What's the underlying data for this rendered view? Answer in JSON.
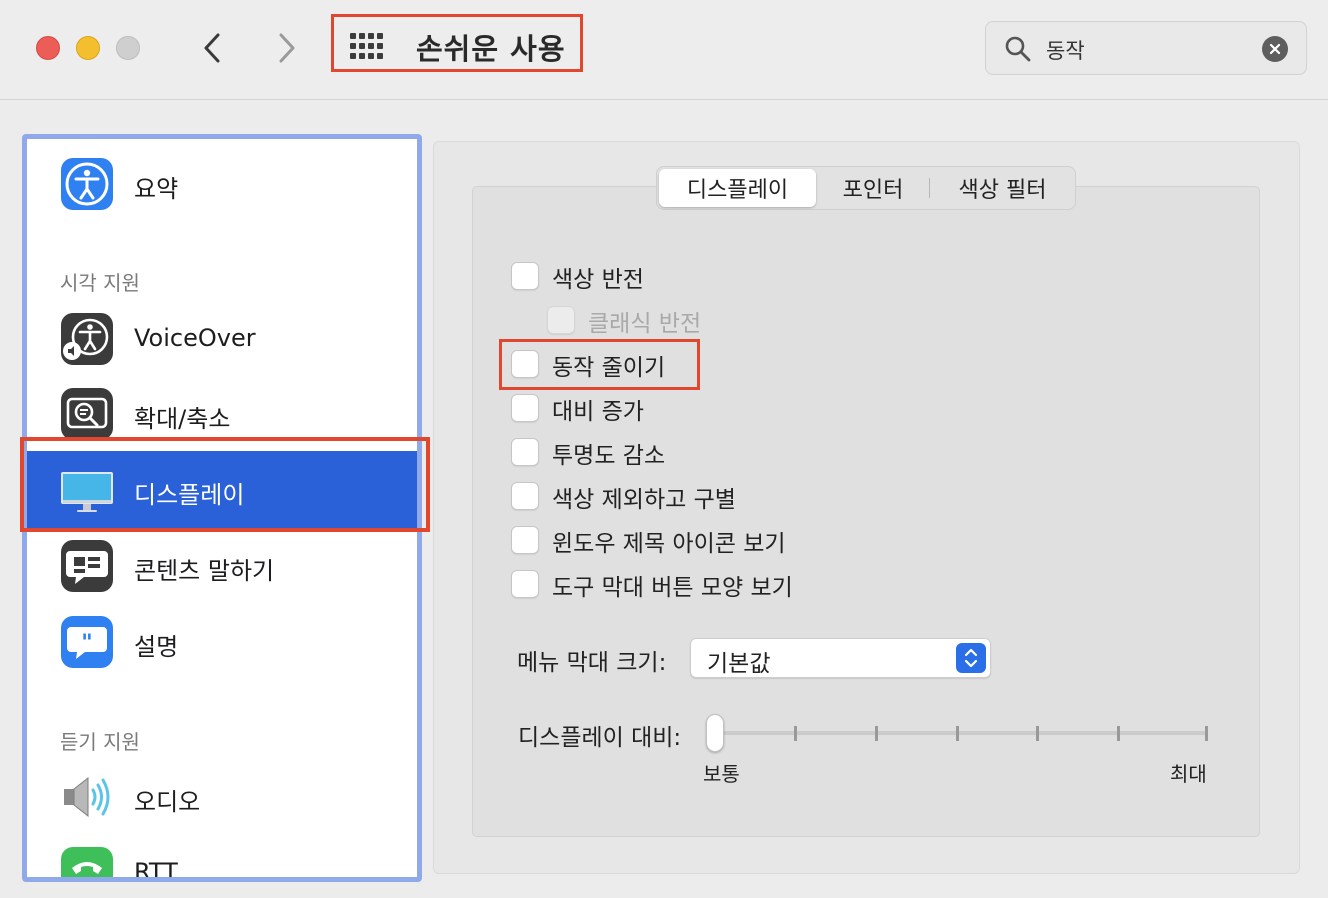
{
  "window": {
    "title": "손쉬운 사용",
    "search_query": "동작"
  },
  "sidebar": {
    "items": [
      {
        "label": "요약",
        "icon": "accessibility-summary-icon"
      },
      {
        "label": "VoiceOver",
        "icon": "voiceover-icon"
      },
      {
        "label": "확대/축소",
        "icon": "zoom-icon"
      },
      {
        "label": "디스플레이",
        "icon": "display-icon",
        "selected": true
      },
      {
        "label": "콘텐츠 말하기",
        "icon": "spoken-content-icon"
      },
      {
        "label": "설명",
        "icon": "descriptions-icon"
      },
      {
        "label": "오디오",
        "icon": "audio-speaker-icon"
      },
      {
        "label": "RTT",
        "icon": "rtt-phone-icon"
      }
    ],
    "sections": {
      "vision": "시각 지원",
      "hearing": "듣기 지원"
    }
  },
  "tabs": [
    {
      "label": "디스플레이",
      "active": true
    },
    {
      "label": "포인터",
      "active": false
    },
    {
      "label": "색상 필터",
      "active": false
    }
  ],
  "options": [
    {
      "label": "색상 반전",
      "checked": false,
      "enabled": true
    },
    {
      "label": "클래식 반전",
      "checked": false,
      "enabled": false
    },
    {
      "label": "동작 줄이기",
      "checked": false,
      "enabled": true
    },
    {
      "label": "대비 증가",
      "checked": false,
      "enabled": true
    },
    {
      "label": "투명도 감소",
      "checked": false,
      "enabled": true
    },
    {
      "label": "색상 제외하고 구별",
      "checked": false,
      "enabled": true
    },
    {
      "label": "윈도우 제목 아이콘 보기",
      "checked": false,
      "enabled": true
    },
    {
      "label": "도구 막대 버튼 모양 보기",
      "checked": false,
      "enabled": true
    }
  ],
  "menu_bar_size": {
    "label": "메뉴 막대 크기:",
    "value": "기본값"
  },
  "display_contrast": {
    "label": "디스플레이 대비:",
    "min_label": "보통",
    "max_label": "최대",
    "value": 0
  },
  "colors": {
    "selected": "#2a61d8",
    "highlight": "#e0472e",
    "sidebar_border": "#8fa9ea"
  }
}
